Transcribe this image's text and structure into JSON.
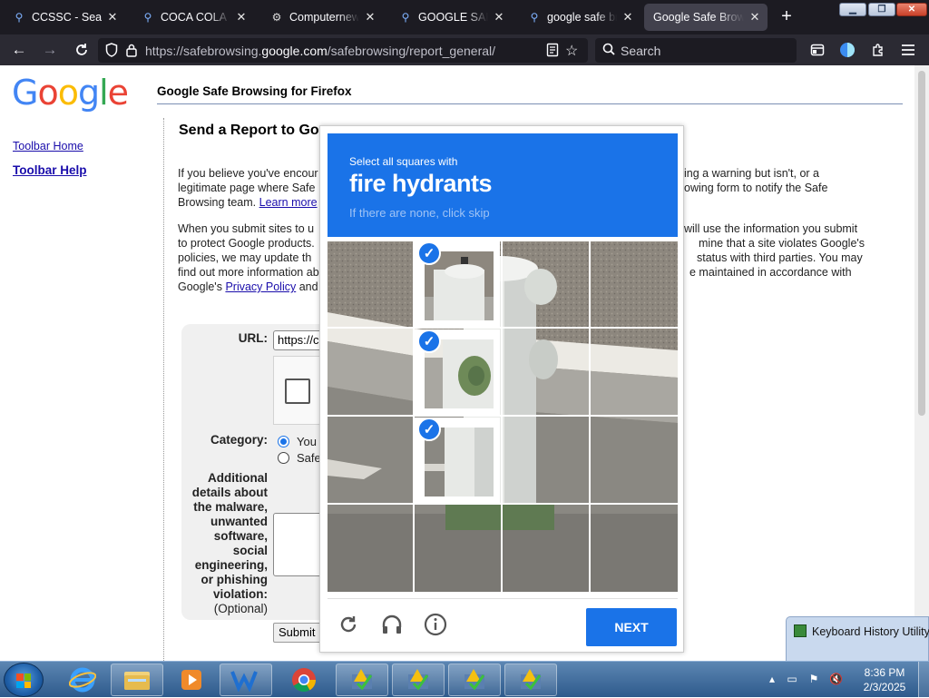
{
  "browser": {
    "tabs": [
      {
        "label": "CCSSC - Search",
        "icon": "search-icon"
      },
      {
        "label": "COCA COLA - S",
        "icon": "search-icon"
      },
      {
        "label": "Computernewb",
        "icon": "site-icon"
      },
      {
        "label": "GOOGLE SAFE B",
        "icon": "search-icon"
      },
      {
        "label": "google safe bro",
        "icon": "search-icon"
      },
      {
        "label": "Google Safe Browsin",
        "icon": "none",
        "active": true
      }
    ],
    "url_prefix": "https://safebrowsing.",
    "url_domain": "google.com",
    "url_suffix": "/safebrowsing/report_general/",
    "search_placeholder": "Search"
  },
  "page": {
    "logo": [
      "G",
      "o",
      "o",
      "g",
      "l",
      "e"
    ],
    "heading": "Google Safe Browsing for Firefox",
    "sidebar": {
      "toolbar_home": "Toolbar Home",
      "toolbar_help": "Toolbar Help"
    },
    "report_title": "Send a Report to Goo",
    "para1_line1": "If you believe you've encour",
    "para1_line2": "legitimate page where Safe",
    "para1_line3": "Browsing team.",
    "learn_more": "Learn more",
    "para1_right1": "ing a warning but isn't, or a",
    "para1_right2": "owing form to notify the Safe",
    "para2_line1": "When you submit sites to u",
    "para2_line2": "to protect Google products.",
    "para2_line3": "policies, we may update th",
    "para2_line4": "find out more information ab",
    "para2_line5_pre": "Google's",
    "privacy_policy": "Privacy Policy",
    "para2_line5_post": "and",
    "para2_right1": "will use the information you submit",
    "para2_right2": "mine that a site violates Google's",
    "para2_right3": "status with third parties. You may",
    "para2_right4": "e maintained in accordance with",
    "form": {
      "url_label": "URL:",
      "url_value": "https://c",
      "category_label": "Category:",
      "radio1": "You",
      "radio2": "Safe",
      "details_label_1": "Additional",
      "details_label_2": "details about",
      "details_label_3": "the malware,",
      "details_label_4": "unwanted",
      "details_label_5": "software,",
      "details_label_6": "social",
      "details_label_7": "engineering,",
      "details_label_8": "or phishing",
      "details_label_9": "violation:",
      "optional": "(Optional)",
      "submit": "Submit"
    }
  },
  "recaptcha": {
    "instruction": "Select all squares with",
    "target": "fire hydrants",
    "hint": "If there are none, click skip",
    "selected_tiles": [
      1,
      5,
      9
    ],
    "next": "NEXT",
    "icons": [
      "reload-icon",
      "audio-icon",
      "info-icon"
    ],
    "accent": "#1a73e8"
  },
  "popup": {
    "title": "Keyboard History Utility"
  },
  "taskbar": {
    "time": "8:36 PM",
    "date": "2/3/2025"
  }
}
